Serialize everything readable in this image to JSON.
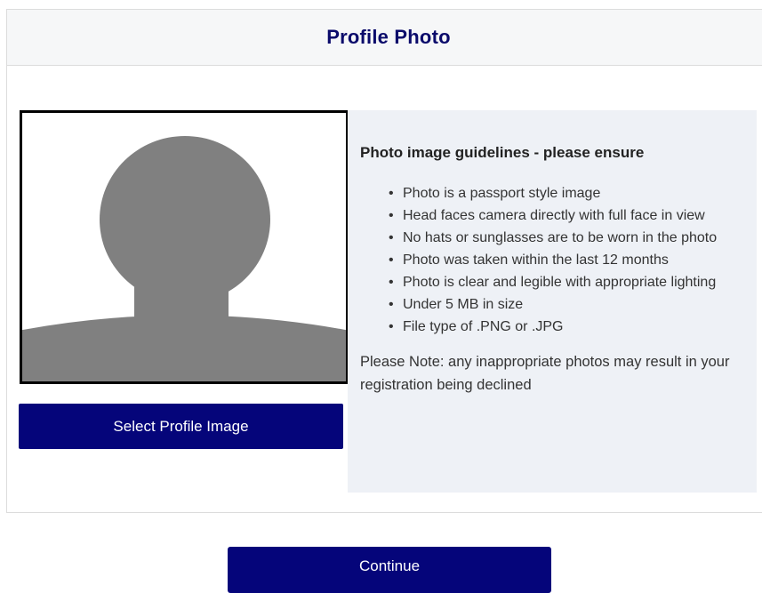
{
  "header": {
    "title": "Profile Photo"
  },
  "photo": {
    "placeholder_icon": "avatar-silhouette-icon",
    "fill_color": "#808080"
  },
  "select_button": {
    "label": "Select Profile Image"
  },
  "guidelines": {
    "heading": "Photo image guidelines - please ensure",
    "items": [
      "Photo is a passport style image",
      "Head faces camera directly with full face in view",
      "No hats or sunglasses are to be worn in the photo",
      "Photo was taken within the last 12 months",
      "Photo is clear and legible with appropriate lighting",
      "Under 5 MB in size",
      "File type of .PNG or .JPG"
    ],
    "note": "Please Note: any inappropriate photos may result in your registration being declined"
  },
  "continue_button": {
    "label": "Continue"
  },
  "colors": {
    "brand": "#05057a",
    "title": "#0b0b6b",
    "panel_bg": "#eef1f6",
    "header_bg": "#f6f7f8"
  }
}
